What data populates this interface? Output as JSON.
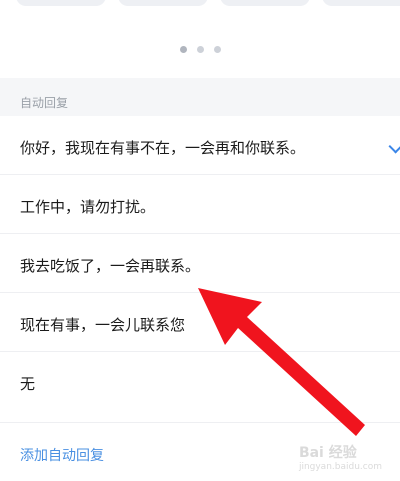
{
  "carousel": {
    "pages": 3,
    "active_index": 0
  },
  "section": {
    "title": "自动回复"
  },
  "replies": [
    {
      "text": "你好，我现在有事不在，一会再和你联系。",
      "selected": true
    },
    {
      "text": "工作中，请勿打扰。",
      "selected": false
    },
    {
      "text": "我去吃饭了，一会再联系。",
      "selected": false
    },
    {
      "text": "现在有事，一会儿联系您",
      "selected": false
    },
    {
      "text": "无",
      "selected": false
    }
  ],
  "add_button": {
    "label": "添加自动回复"
  },
  "watermark": {
    "brand": "Bai 经验",
    "url": "jingyan.baidu.com"
  },
  "colors": {
    "accent": "#4a90e2",
    "annotation_arrow": "#f0141e",
    "section_bg": "#f5f6f8"
  }
}
